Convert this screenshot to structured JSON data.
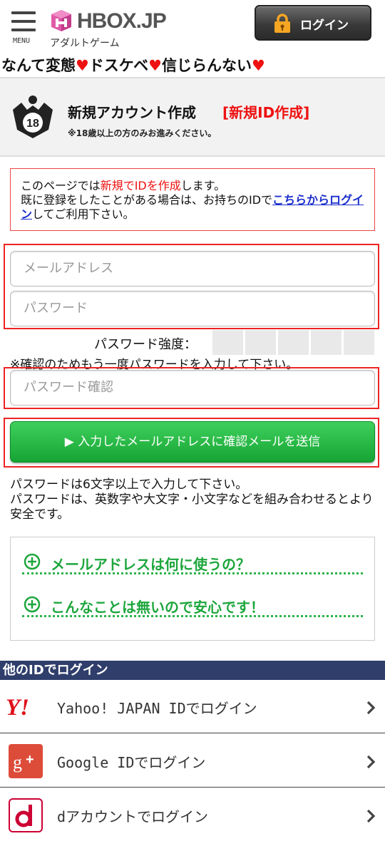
{
  "header": {
    "menu_label": "MENU",
    "logo_text": "HBOX.JP",
    "subtitle": "アダルトゲーム",
    "login_label": "ログイン"
  },
  "tagline": {
    "part1": "なんて変態",
    "part2": "ドスケベ",
    "part3": "信じらんない",
    "heart": "♥"
  },
  "title": {
    "main": "新規アカウント作成",
    "badge": "[新規ID作成]",
    "note": "※18歳以上の方のみお進みください。",
    "age_icon_text": "18"
  },
  "notice": {
    "line1_a": "このページでは",
    "line1_red": "新規でIDを作成",
    "line1_b": "します。",
    "line2_a": "既に登録をしたことがある場合は、お持ちのIDで",
    "link": "こちらからログイン",
    "line3_b": "してご利用下さい。"
  },
  "form": {
    "email_placeholder": "メールアドレス",
    "password_placeholder": "パスワード",
    "strength_label": "パスワード強度：",
    "confirm_note": "※確認のためもう一度パスワードを入力して下さい。",
    "confirm_placeholder": "パスワード確認",
    "send_label": "▶ 入力したメールアドレスに確認メールを送信",
    "help_line1": "パスワードは6文字以上で入力して下さい。",
    "help_line2": "パスワードは、英数字や大文字・小文字などを組み合わせるとより安全です。"
  },
  "faq": {
    "q1": "メールアドレスは何に使うの？",
    "q2": "こんなことは無いので安心です！"
  },
  "other_login": {
    "heading": "他のIDでログイン",
    "items": [
      {
        "label": "Yahoo! JAPAN IDでログイン",
        "icon": "yahoo-logo-icon"
      },
      {
        "label": "Google IDでログイン",
        "icon": "google-plus-icon"
      },
      {
        "label": "dアカウントでログイン",
        "icon": "docomo-d-icon"
      }
    ]
  },
  "colors": {
    "accent_red": "#ee1111",
    "button_green": "#22b640",
    "link_blue": "#1a2ecc",
    "section_navy": "#2f3e6b"
  }
}
